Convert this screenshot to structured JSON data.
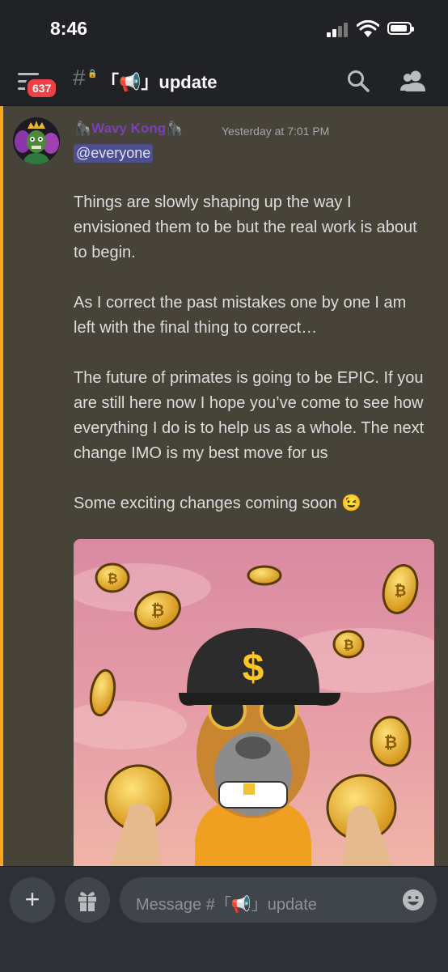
{
  "status_bar": {
    "time": "8:46"
  },
  "header": {
    "unread_count": "637",
    "channel_name": "「📢」update",
    "icons": [
      "menu-icon",
      "hash-icon",
      "search-icon",
      "members-icon"
    ]
  },
  "message": {
    "author": "🦍Wavy Kong🦍",
    "timestamp": "Yesterday at 7:01 PM",
    "mention": "@everyone",
    "paragraphs": [
      "Things are slowly shaping up the way I envisioned them to be but the real work is about to begin.",
      "As I correct the past mistakes one by one I am left with the final thing to correct…",
      "The future of primates is going to be EPIC. If you are still here now I hope you’ve come to see how everything I do is to help us as a whole. The next change IMO is my best move for us",
      "Some exciting changes coming soon 😉"
    ],
    "attachment": {
      "type": "image",
      "subject": "ape-with-dollar-cap-and-bitcoins",
      "cap_symbol": "$"
    }
  },
  "composer": {
    "placeholder": "Message #「📢」update",
    "icons": [
      "plus-icon",
      "gift-icon",
      "emoji-icon"
    ]
  },
  "colors": {
    "header_bg": "#202225",
    "message_highlight": "#484338",
    "mention_bar": "#faa81a",
    "author": "#7b3fbb",
    "badge": "#ed4245",
    "mention_bg": "#4d4f8f"
  }
}
